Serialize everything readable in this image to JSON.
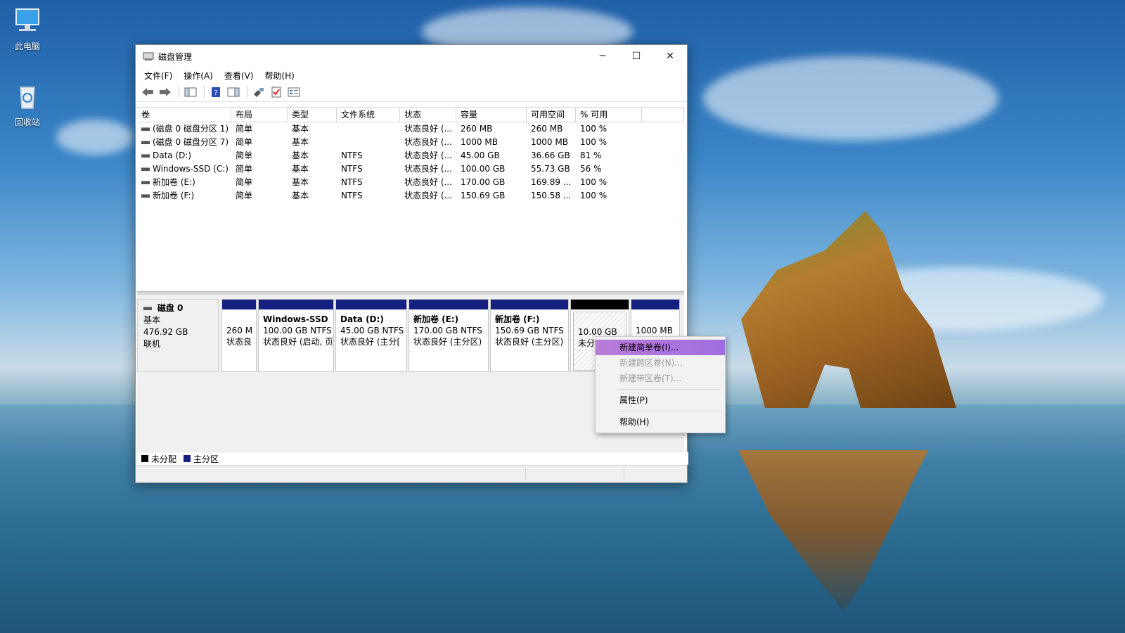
{
  "desktop": {
    "icons": [
      {
        "label": "此电脑"
      },
      {
        "label": "回收站"
      }
    ]
  },
  "window": {
    "title": "磁盘管理",
    "controls": {
      "minimize": "─",
      "maximize": "☐",
      "close": "✕"
    },
    "menu": [
      "文件(F)",
      "操作(A)",
      "查看(V)",
      "帮助(H)"
    ]
  },
  "table": {
    "columns": [
      "卷",
      "布局",
      "类型",
      "文件系统",
      "状态",
      "容量",
      "可用空间",
      "% 可用",
      ""
    ],
    "rows": [
      [
        "(磁盘 0 磁盘分区 1)",
        "简单",
        "基本",
        "",
        "状态良好 (...",
        "260 MB",
        "260 MB",
        "100 %"
      ],
      [
        "(磁盘 0 磁盘分区 7)",
        "简单",
        "基本",
        "",
        "状态良好 (...",
        "1000 MB",
        "1000 MB",
        "100 %"
      ],
      [
        "Data (D:)",
        "简单",
        "基本",
        "NTFS",
        "状态良好 (...",
        "45.00 GB",
        "36.66 GB",
        "81 %"
      ],
      [
        "Windows-SSD (C:)",
        "简单",
        "基本",
        "NTFS",
        "状态良好 (...",
        "100.00 GB",
        "55.73 GB",
        "56 %"
      ],
      [
        "新加卷 (E:)",
        "简单",
        "基本",
        "NTFS",
        "状态良好 (...",
        "170.00 GB",
        "169.89 ...",
        "100 %"
      ],
      [
        "新加卷 (F:)",
        "简单",
        "基本",
        "NTFS",
        "状态良好 (...",
        "150.69 GB",
        "150.58 ...",
        "100 %"
      ]
    ]
  },
  "disk": {
    "name": "磁盘 0",
    "type": "基本",
    "size": "476.92 GB",
    "status": "联机",
    "partitions": [
      {
        "name": "",
        "size": "260 M",
        "status": "状态良"
      },
      {
        "name": "Windows-SSD",
        "size": "100.00 GB NTFS",
        "status": "状态良好 (启动, 页"
      },
      {
        "name": "Data  (D:)",
        "size": "45.00 GB NTFS",
        "status": "状态良好 (主分["
      },
      {
        "name": "新加卷  (E:)",
        "size": "170.00 GB NTFS",
        "status": "状态良好 (主分区)"
      },
      {
        "name": "新加卷  (F:)",
        "size": "150.69 GB NTFS",
        "status": "状态良好 (主分区)"
      },
      {
        "name": "",
        "size": "10.00 GB",
        "status": "未分"
      },
      {
        "name": "",
        "size": "1000 MB",
        "status": ""
      }
    ]
  },
  "legend": [
    {
      "label": "未分配",
      "color": "#000000"
    },
    {
      "label": "主分区",
      "color": "#13207f"
    }
  ],
  "context_menu": {
    "items": [
      "新建简单卷(I)...",
      "新建跨区卷(N)...",
      "新建带区卷(T)...",
      "属性(P)",
      "帮助(H)"
    ]
  }
}
